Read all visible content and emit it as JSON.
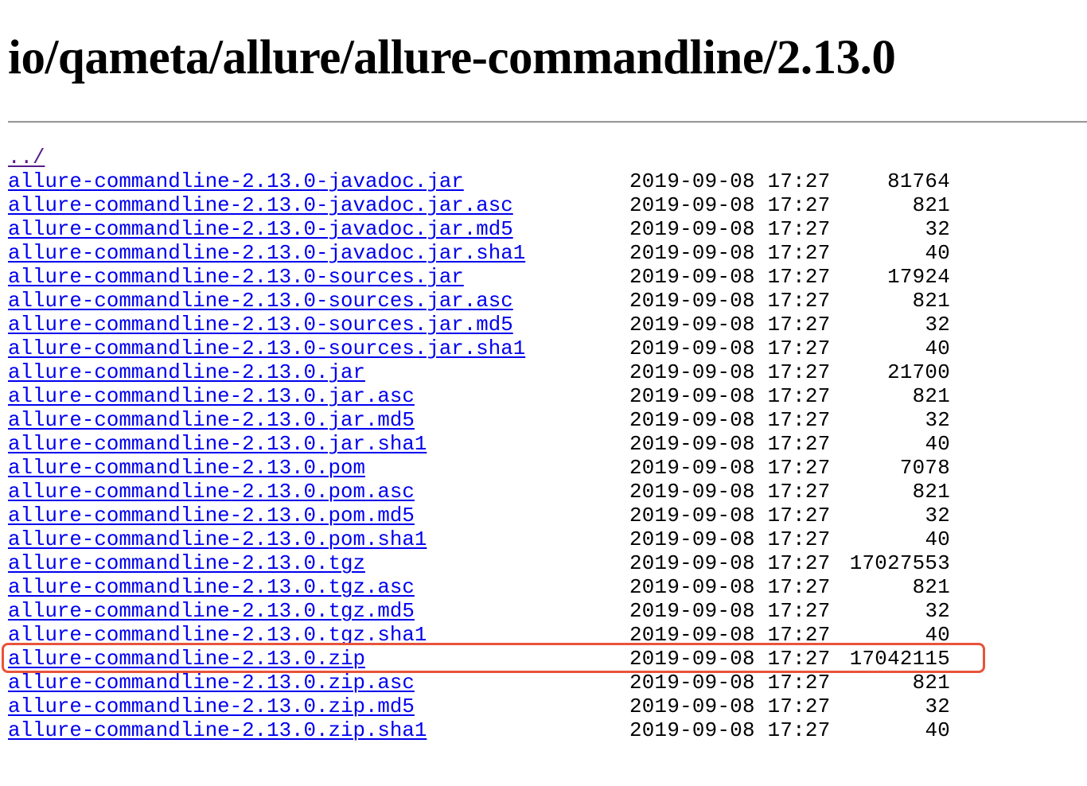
{
  "page": {
    "title": "io/qameta/allure/allure-commandline/2.13.0"
  },
  "listing": {
    "parent": "../",
    "files": [
      {
        "name": "allure-commandline-2.13.0-javadoc.jar",
        "date": "2019-09-08 17:27",
        "size": "81764"
      },
      {
        "name": "allure-commandline-2.13.0-javadoc.jar.asc",
        "date": "2019-09-08 17:27",
        "size": "821"
      },
      {
        "name": "allure-commandline-2.13.0-javadoc.jar.md5",
        "date": "2019-09-08 17:27",
        "size": "32"
      },
      {
        "name": "allure-commandline-2.13.0-javadoc.jar.sha1",
        "date": "2019-09-08 17:27",
        "size": "40"
      },
      {
        "name": "allure-commandline-2.13.0-sources.jar",
        "date": "2019-09-08 17:27",
        "size": "17924"
      },
      {
        "name": "allure-commandline-2.13.0-sources.jar.asc",
        "date": "2019-09-08 17:27",
        "size": "821"
      },
      {
        "name": "allure-commandline-2.13.0-sources.jar.md5",
        "date": "2019-09-08 17:27",
        "size": "32"
      },
      {
        "name": "allure-commandline-2.13.0-sources.jar.sha1",
        "date": "2019-09-08 17:27",
        "size": "40"
      },
      {
        "name": "allure-commandline-2.13.0.jar",
        "date": "2019-09-08 17:27",
        "size": "21700"
      },
      {
        "name": "allure-commandline-2.13.0.jar.asc",
        "date": "2019-09-08 17:27",
        "size": "821"
      },
      {
        "name": "allure-commandline-2.13.0.jar.md5",
        "date": "2019-09-08 17:27",
        "size": "32"
      },
      {
        "name": "allure-commandline-2.13.0.jar.sha1",
        "date": "2019-09-08 17:27",
        "size": "40"
      },
      {
        "name": "allure-commandline-2.13.0.pom",
        "date": "2019-09-08 17:27",
        "size": "7078"
      },
      {
        "name": "allure-commandline-2.13.0.pom.asc",
        "date": "2019-09-08 17:27",
        "size": "821"
      },
      {
        "name": "allure-commandline-2.13.0.pom.md5",
        "date": "2019-09-08 17:27",
        "size": "32"
      },
      {
        "name": "allure-commandline-2.13.0.pom.sha1",
        "date": "2019-09-08 17:27",
        "size": "40"
      },
      {
        "name": "allure-commandline-2.13.0.tgz",
        "date": "2019-09-08 17:27",
        "size": "17027553"
      },
      {
        "name": "allure-commandline-2.13.0.tgz.asc",
        "date": "2019-09-08 17:27",
        "size": "821"
      },
      {
        "name": "allure-commandline-2.13.0.tgz.md5",
        "date": "2019-09-08 17:27",
        "size": "32"
      },
      {
        "name": "allure-commandline-2.13.0.tgz.sha1",
        "date": "2019-09-08 17:27",
        "size": "40"
      },
      {
        "name": "allure-commandline-2.13.0.zip",
        "date": "2019-09-08 17:27",
        "size": "17042115"
      },
      {
        "name": "allure-commandline-2.13.0.zip.asc",
        "date": "2019-09-08 17:27",
        "size": "821"
      },
      {
        "name": "allure-commandline-2.13.0.zip.md5",
        "date": "2019-09-08 17:27",
        "size": "32"
      },
      {
        "name": "allure-commandline-2.13.0.zip.sha1",
        "date": "2019-09-08 17:27",
        "size": "40"
      }
    ]
  },
  "colors": {
    "link": "#0000ee",
    "visited_link": "#551a8b",
    "highlight_box": "#e8543a"
  }
}
